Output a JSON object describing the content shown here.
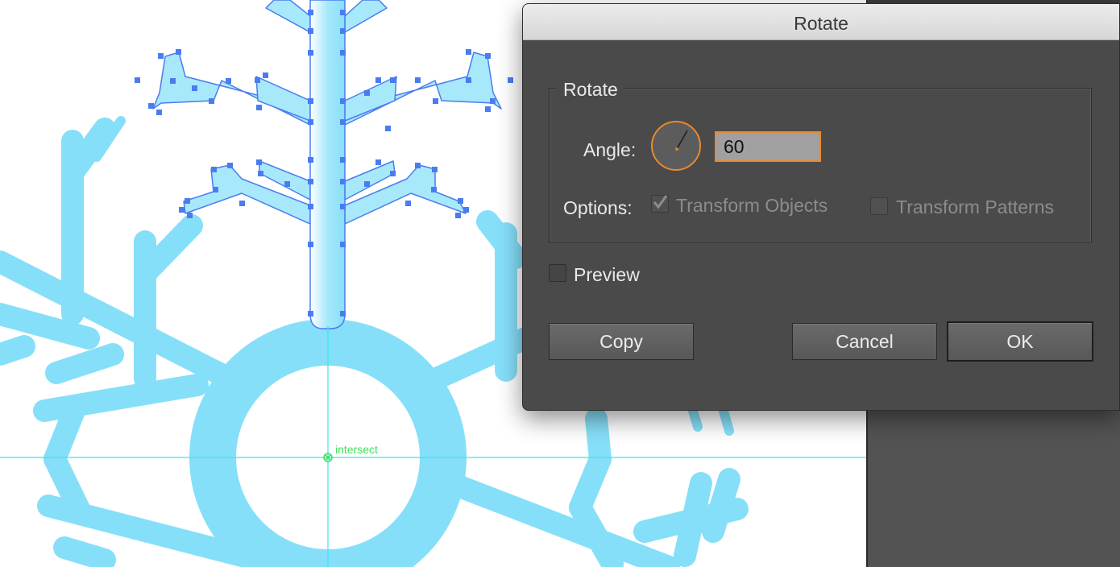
{
  "dialog": {
    "title": "Rotate",
    "group_label": "Rotate",
    "angle_label": "Angle:",
    "angle_value": "60",
    "options_label": "Options:",
    "transform_objects": {
      "label": "Transform Objects",
      "checked": true,
      "enabled": false
    },
    "transform_patterns": {
      "label": "Transform Patterns",
      "checked": false,
      "enabled": false
    },
    "preview": {
      "label": "Preview",
      "checked": false
    },
    "buttons": {
      "copy": "Copy",
      "cancel": "Cancel",
      "ok": "OK"
    }
  },
  "canvas": {
    "smart_guide_label": "intersect",
    "colors": {
      "snowflake": "#86dff8",
      "selection": "#4a7cf0",
      "guide": "#35e8f0",
      "smart_guide_text": "#3ee05a"
    }
  },
  "theme": {
    "dialog_bg": "#4a4a4a",
    "accent": "#e88b2d"
  }
}
